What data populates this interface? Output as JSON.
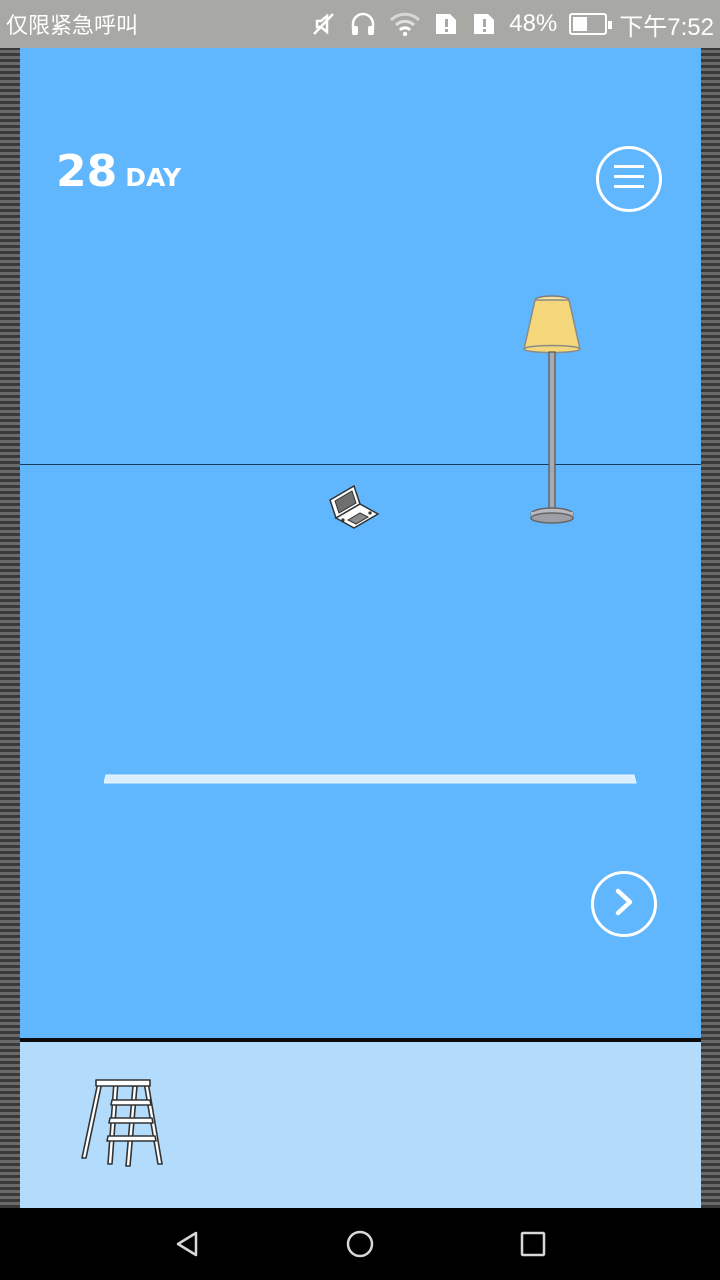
{
  "status_bar": {
    "carrier_text": "仅限紧急呼叫",
    "battery_percent": "48%",
    "battery_level": 0.48,
    "time": "下午7:52",
    "icons": [
      "mute-vibrate-icon",
      "headphones-icon",
      "wifi-icon",
      "sim1-alert-icon",
      "sim2-alert-icon",
      "battery-icon"
    ]
  },
  "game": {
    "day_number": "28",
    "day_label": "DAY",
    "buttons": {
      "menu": "menu-icon",
      "next": "chevron-right-icon"
    },
    "room_objects": [
      "floor-lamp",
      "portable-game-console",
      "wall-shelf"
    ],
    "colors": {
      "room": "#61b7fd",
      "inventory": "#b3dcfc",
      "lamp_shade": "#f3d77a"
    }
  },
  "inventory": {
    "items": [
      {
        "name": "step-ladder",
        "icon": "step-ladder-icon"
      }
    ]
  },
  "nav_bar": {
    "buttons": [
      "back-icon",
      "home-icon",
      "recent-apps-icon"
    ]
  }
}
